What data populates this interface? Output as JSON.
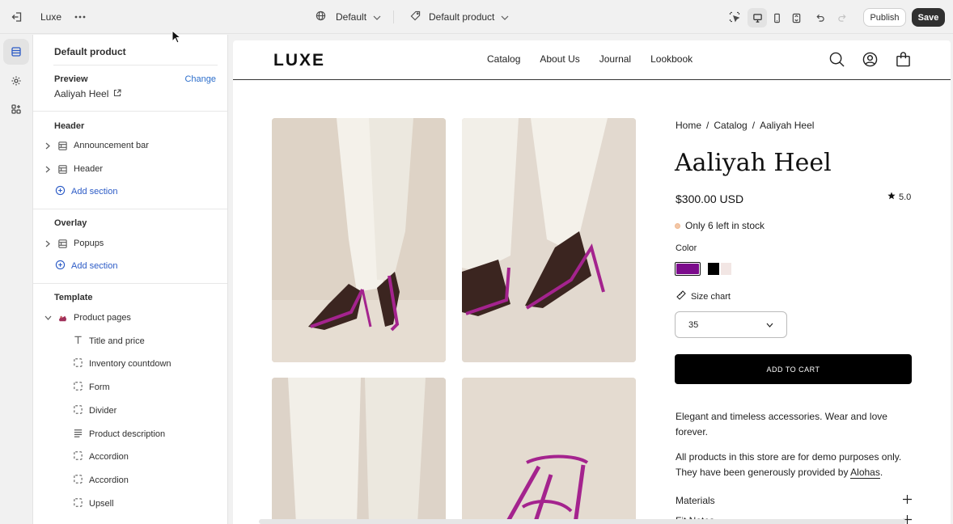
{
  "topbar": {
    "store_name": "Luxe",
    "theme_label": "Default",
    "template_label": "Default product",
    "publish_label": "Publish",
    "save_label": "Save"
  },
  "sidebar": {
    "title": "Default product",
    "preview_label": "Preview",
    "change_label": "Change",
    "preview_value": "Aaliyah Heel",
    "header_group": "Header",
    "header_items": [
      "Announcement bar",
      "Header"
    ],
    "add_section": "Add section",
    "overlay_group": "Overlay",
    "overlay_items": [
      "Popups"
    ],
    "template_group": "Template",
    "template_root": "Product pages",
    "template_blocks": [
      "Title and price",
      "Inventory countdown",
      "Form",
      "Divider",
      "Product description",
      "Accordion",
      "Accordion",
      "Upsell"
    ]
  },
  "store": {
    "logo": "LUXE",
    "nav": [
      "Catalog",
      "About Us",
      "Journal",
      "Lookbook"
    ],
    "breadcrumb": [
      "Home",
      "/",
      "Catalog",
      "/",
      "Aaliyah Heel"
    ],
    "product_title": "Aaliyah Heel",
    "price": "$300.00 USD",
    "rating": "5.0",
    "stock_text": "Only 6 left in stock",
    "color_label": "Color",
    "swatches": [
      "#7c0c8c",
      "#000000",
      "#f2e6e4"
    ],
    "size_chart_label": "Size chart",
    "size_value": "35",
    "add_to_cart": "ADD TO CART",
    "desc1": "Elegant and timeless accessories. Wear and love forever.",
    "desc2_prefix": "All products in this store are for demo purposes only. They have been generously provided by ",
    "desc2_link": "Alohas",
    "desc2_suffix": ".",
    "accordions": [
      "Materials",
      "Fit Notes"
    ],
    "accent_color": "#8a1a86"
  }
}
